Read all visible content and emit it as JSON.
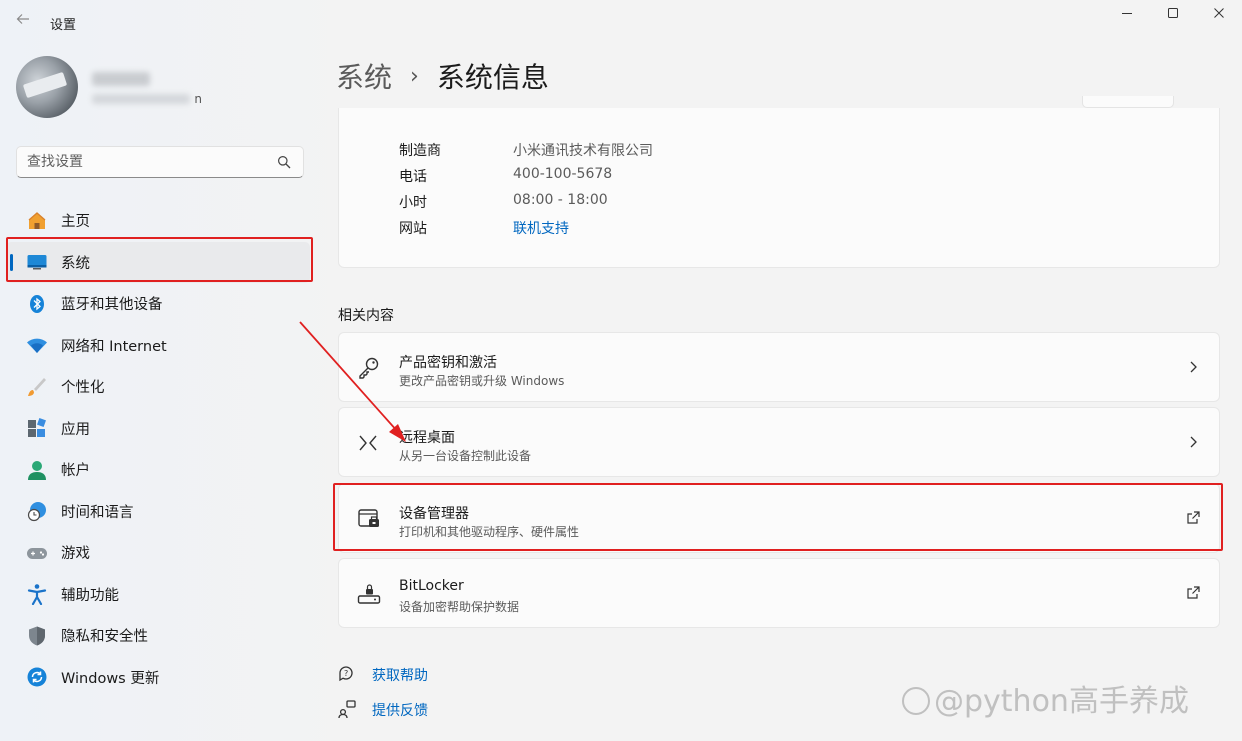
{
  "window": {
    "title": "设置",
    "controls": {
      "minimize": "—",
      "maximize": "☐",
      "close": "✕"
    }
  },
  "user": {
    "email_suffix": "n"
  },
  "search": {
    "placeholder": "查找设置"
  },
  "sidebar": {
    "items": [
      {
        "label": "主页",
        "icon": "home-icon",
        "active": false
      },
      {
        "label": "系统",
        "icon": "system-display-icon",
        "active": true
      },
      {
        "label": "蓝牙和其他设备",
        "icon": "bluetooth-icon",
        "active": false
      },
      {
        "label": "网络和 Internet",
        "icon": "wifi-icon",
        "active": false
      },
      {
        "label": "个性化",
        "icon": "paintbrush-icon",
        "active": false
      },
      {
        "label": "应用",
        "icon": "apps-icon",
        "active": false
      },
      {
        "label": "帐户",
        "icon": "account-icon",
        "active": false
      },
      {
        "label": "时间和语言",
        "icon": "globe-clock-icon",
        "active": false
      },
      {
        "label": "游戏",
        "icon": "gamepad-icon",
        "active": false
      },
      {
        "label": "辅助功能",
        "icon": "accessibility-icon",
        "active": false
      },
      {
        "label": "隐私和安全性",
        "icon": "shield-icon",
        "active": false
      },
      {
        "label": "Windows 更新",
        "icon": "update-icon",
        "active": false
      }
    ]
  },
  "breadcrumb": {
    "parent": "系统",
    "separator": "›",
    "current": "系统信息"
  },
  "support": {
    "rows": [
      {
        "key": "制造商",
        "value": "小米通讯技术有限公司",
        "is_link": false
      },
      {
        "key": "电话",
        "value": "400-100-5678",
        "is_link": false
      },
      {
        "key": "小时",
        "value": "08:00 - 18:00",
        "is_link": false
      },
      {
        "key": "网站",
        "value": "联机支持",
        "is_link": true
      }
    ]
  },
  "related": {
    "title": "相关内容",
    "items": [
      {
        "title": "产品密钥和激活",
        "subtitle": "更改产品密钥或升级 Windows",
        "icon": "key-icon",
        "trail": "chevron-right-icon"
      },
      {
        "title": "远程桌面",
        "subtitle": "从另一台设备控制此设备",
        "icon": "remote-desktop-icon",
        "trail": "chevron-right-icon"
      },
      {
        "title": "设备管理器",
        "subtitle": "打印机和其他驱动程序、硬件属性",
        "icon": "device-manager-icon",
        "trail": "external-link-icon"
      },
      {
        "title": "BitLocker",
        "subtitle": "设备加密帮助保护数据",
        "icon": "lock-drive-icon",
        "trail": "external-link-icon"
      }
    ]
  },
  "help_links": [
    {
      "label": "获取帮助",
      "icon": "help-chat-icon"
    },
    {
      "label": "提供反馈",
      "icon": "feedback-icon"
    }
  ],
  "watermark": {
    "text": "@python高手养成"
  },
  "colors": {
    "accent": "#0067c0",
    "highlight_box": "#e02020",
    "arrow": "#e02020"
  }
}
